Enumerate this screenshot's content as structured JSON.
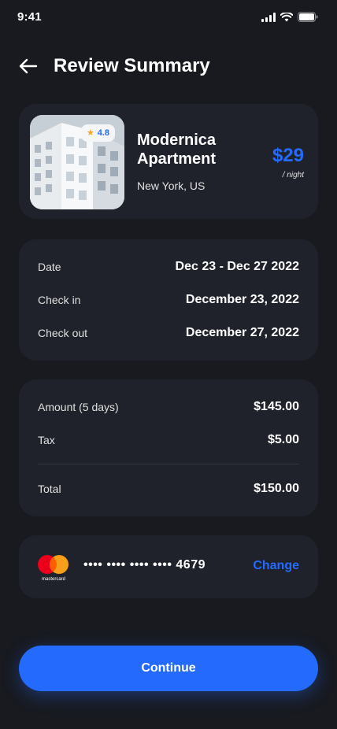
{
  "status_bar": {
    "time": "9:41"
  },
  "header": {
    "title": "Review Summary",
    "back_icon": "arrow-left-icon"
  },
  "hotel": {
    "rating": "4.8",
    "name": "Modernica Apartment",
    "location": "New York, US",
    "price": "$29",
    "price_unit": "/ night"
  },
  "dates": [
    {
      "label": "Date",
      "value": "Dec 23 - Dec 27 2022"
    },
    {
      "label": "Check in",
      "value": "December 23, 2022"
    },
    {
      "label": "Check out",
      "value": "December 27, 2022"
    }
  ],
  "amounts": [
    {
      "label": "Amount (5 days)",
      "value": "$145.00"
    },
    {
      "label": "Tax",
      "value": "$5.00"
    }
  ],
  "total": {
    "label": "Total",
    "value": "$150.00"
  },
  "payment": {
    "brand": "mastercard",
    "masked_number": "•••• •••• •••• •••• 4679",
    "change_label": "Change"
  },
  "continue_label": "Continue",
  "colors": {
    "background": "#181a20",
    "card": "#1f222a",
    "accent": "#246bfd",
    "star": "#f5a623"
  }
}
